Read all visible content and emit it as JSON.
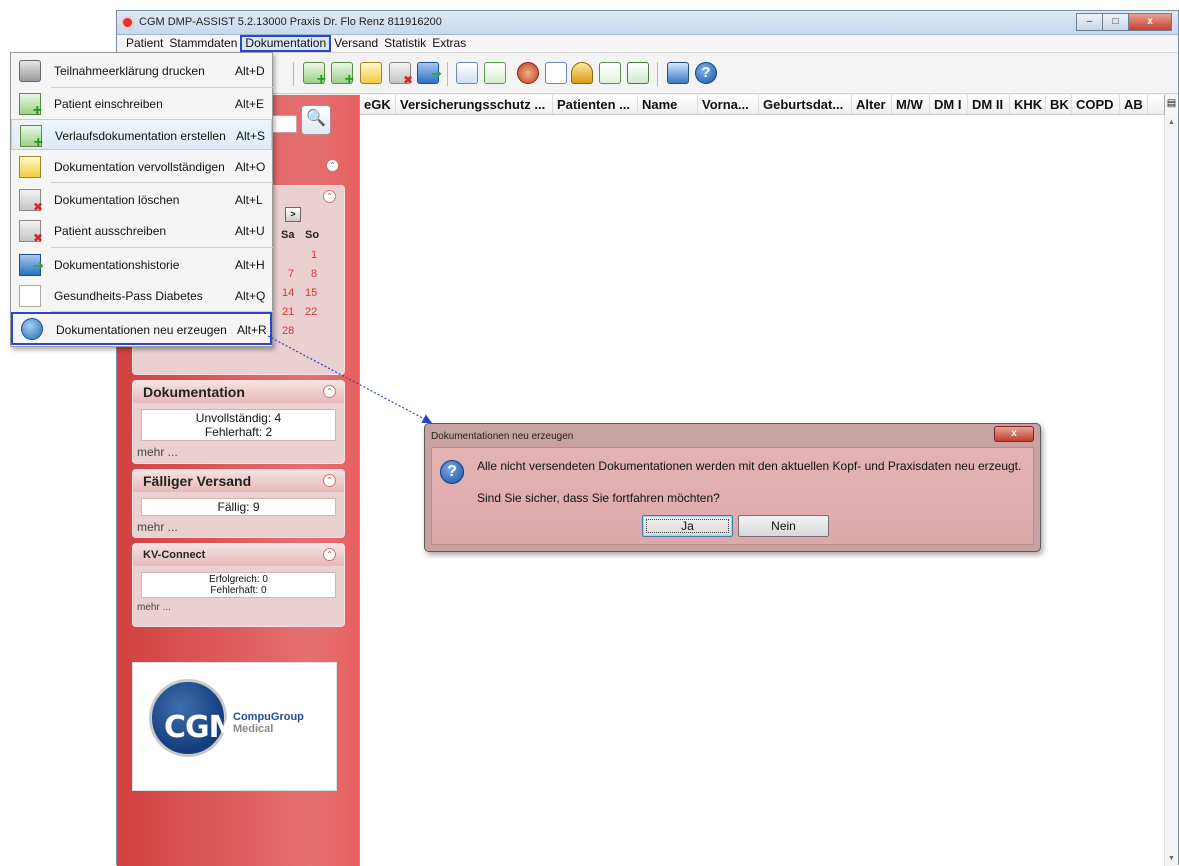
{
  "window": {
    "title": "CGM DMP-ASSIST 5.2.13000 Praxis Dr. Flo Renz 811916200",
    "controls": {
      "minimize": "–",
      "maximize": "□",
      "close": "x"
    }
  },
  "menubar": {
    "items": [
      {
        "label": "Patient"
      },
      {
        "label": "Stammdaten"
      },
      {
        "label": "Dokumentation"
      },
      {
        "label": "Versand"
      },
      {
        "label": "Statistik"
      },
      {
        "label": "Extras"
      }
    ]
  },
  "dropdown": {
    "items": [
      {
        "label": "Teilnahmeerklärung drucken",
        "accel": "Alt+D",
        "icon": "printer-icon"
      },
      {
        "label": "Patient einschreiben",
        "accel": "Alt+E",
        "icon": "document-add-icon"
      },
      {
        "label": "Verlaufsdokumentation erstellen",
        "accel": "Alt+S",
        "icon": "document-add-icon"
      },
      {
        "label": "Dokumentation vervollständigen",
        "accel": "Alt+O",
        "icon": "document-edit-icon"
      },
      {
        "label": "Dokumentation löschen",
        "accel": "Alt+L",
        "icon": "document-delete-icon"
      },
      {
        "label": "Patient ausschreiben",
        "accel": "Alt+U",
        "icon": "document-delete-icon"
      },
      {
        "label": "Dokumentationshistorie",
        "accel": "Alt+H",
        "icon": "history-icon"
      },
      {
        "label": "Gesundheits-Pass Diabetes",
        "accel": "Alt+Q",
        "icon": "paper-icon"
      },
      {
        "label": "Dokumentationen neu erzeugen",
        "accel": "Alt+R",
        "icon": "regenerate-icon"
      }
    ]
  },
  "calendar": {
    "headers": [
      "Sa",
      "So"
    ],
    "days": [
      "1",
      "7",
      "8",
      "14",
      "15",
      "21",
      "22",
      "28"
    ],
    "next_label": ">"
  },
  "panels": {
    "dokumentation": {
      "title": "Dokumentation",
      "lines": [
        "Unvollständig: 4",
        "Fehlerhaft: 2"
      ],
      "more": "mehr ..."
    },
    "versand": {
      "title": "Fälliger Versand",
      "lines": [
        "Fällig: 9"
      ],
      "more": "mehr ..."
    },
    "kvconnect": {
      "title": "KV-Connect",
      "lines": [
        "Erfolgreich: 0",
        "Fehlerhaft: 0"
      ],
      "more": "mehr ..."
    }
  },
  "logo": {
    "mark": "CGM",
    "name": "CompuGroup",
    "sub": "Medical"
  },
  "grid": {
    "columns": [
      "eGK",
      "Versicherungsschutz ...",
      "Patienten ...",
      "Name",
      "Vorna...",
      "Geburtsdat...",
      "Alter",
      "M/W",
      "DM I",
      "DM II",
      "KHK",
      "BK",
      "COPD",
      "AB"
    ]
  },
  "dialog": {
    "title": "Dokumentationen neu erzeugen",
    "message": "Alle nicht versendeten Dokumentationen werden mit den aktuellen Kopf- und Praxisdaten neu erzeugt.",
    "confirm": "Sind Sie sicher, dass Sie fortfahren möchten?",
    "yes": "Ja",
    "no": "Nein"
  }
}
